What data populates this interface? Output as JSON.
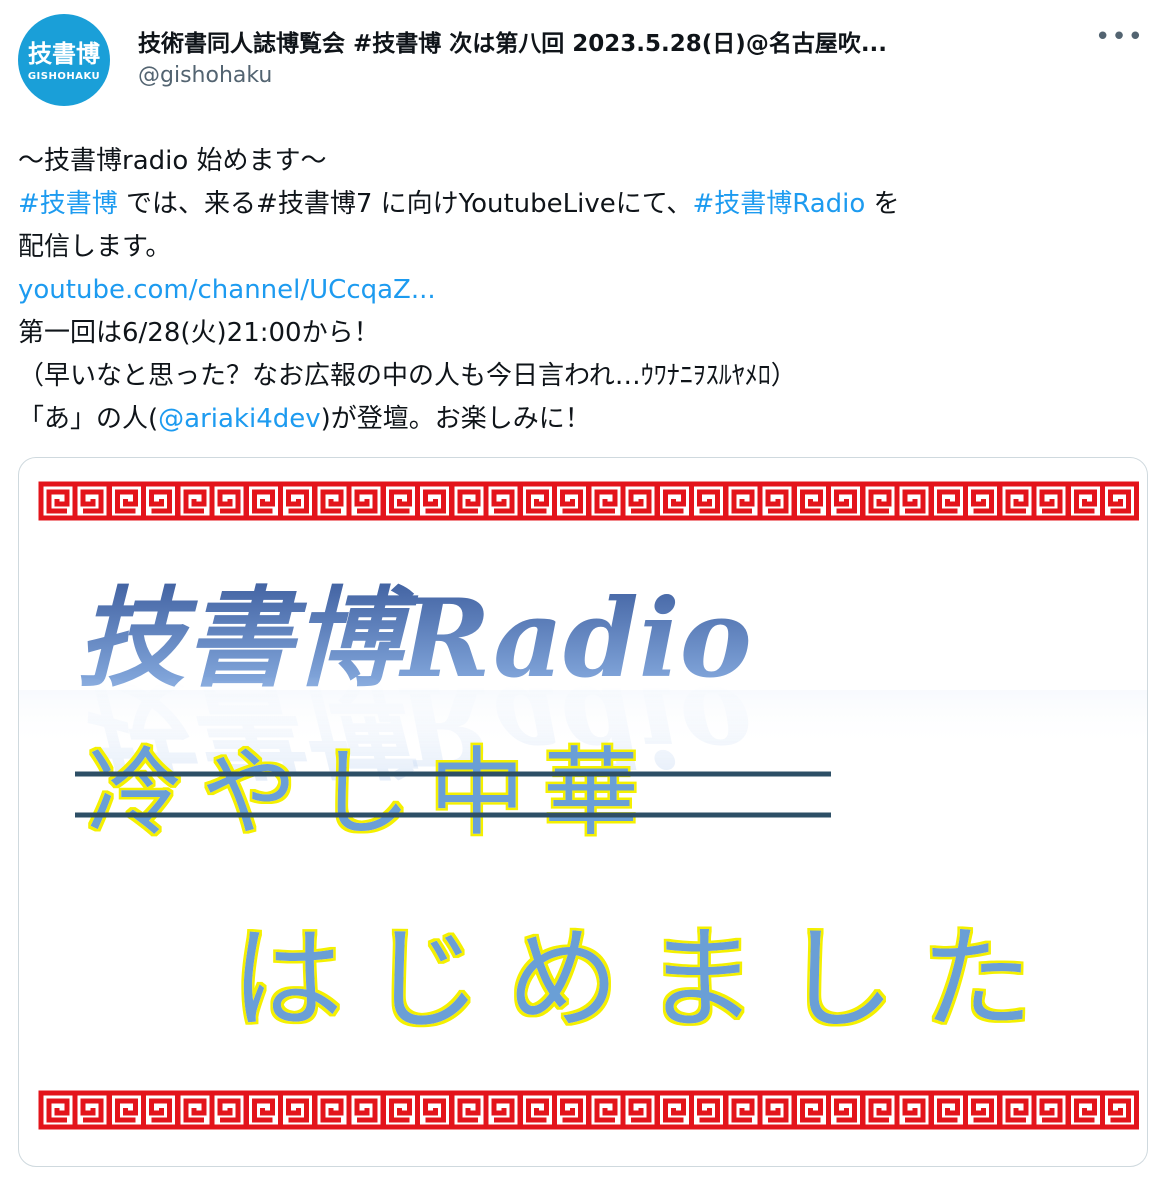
{
  "tweet": {
    "avatar": {
      "kanji": "技書博",
      "roman": "GISHOHAKU",
      "color": "#1a9fd8"
    },
    "display_name": "技術書同人誌博覧会 #技書博 次は第八回 2023.5.28(日)@名古屋吹...",
    "handle": "@gishohaku",
    "more_icon": "more-dots-icon",
    "lines": [
      {
        "segments": [
          {
            "text": "～技書博radio 始めます～"
          }
        ]
      },
      {
        "segments": [
          {
            "text": "#技書博",
            "link": true
          },
          {
            "text": " では、来る#技書博7 に向けYoutubeLiveにて、"
          },
          {
            "text": "#技書博Radio",
            "link": true
          },
          {
            "text": " を"
          }
        ]
      },
      {
        "segments": [
          {
            "text": "配信します。"
          }
        ]
      },
      {
        "segments": [
          {
            "text": "youtube.com/channel/UCcqaZ...",
            "link": true
          }
        ]
      },
      {
        "segments": [
          {
            "text": "第一回は6/28(火)21:00から！"
          }
        ]
      },
      {
        "segments": [
          {
            "text": "（早いなと思った？なお広報の中の人も今日言われ…ｳﾜﾅﾆｦｽﾙﾔﾒﾛ）"
          }
        ]
      },
      {
        "segments": [
          {
            "text": "「あ」の人("
          },
          {
            "text": "@ariaki4dev",
            "link": true
          },
          {
            "text": ")が登壇。お楽しみに！"
          }
        ]
      }
    ],
    "colors": {
      "link": "#1d9bf0",
      "text": "#0f1419",
      "secondary": "#536471"
    }
  },
  "card_image": {
    "title": "技書博Radio",
    "struck_text": "冷やし中華",
    "subtitle": "はじめました",
    "colors": {
      "border_red": "#e3141b",
      "title_blue": "#4a6fb5",
      "text_blue": "#6a9fd6",
      "glow_yellow": "#f4f000",
      "strike": "#2d4f66"
    }
  }
}
